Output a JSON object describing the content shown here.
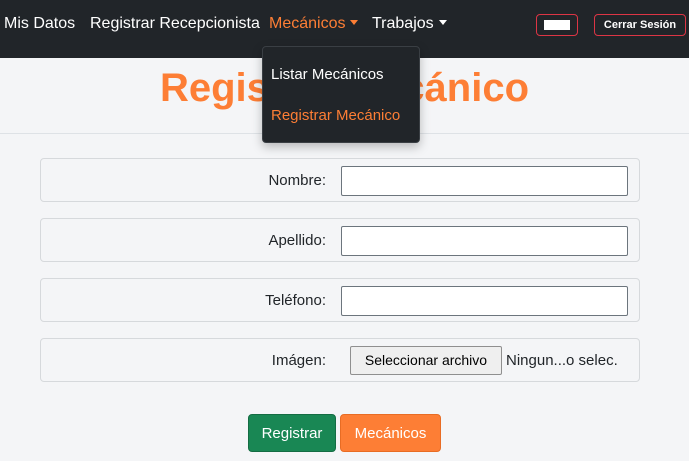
{
  "colors": {
    "accent": "#fd7e35",
    "navbar_bg": "#212529",
    "danger": "#dc3545",
    "success": "#198754"
  },
  "navbar": {
    "items": [
      {
        "label": "Mis Datos"
      },
      {
        "label": "Registrar Recepcionista"
      },
      {
        "label": "Mecánicos"
      },
      {
        "label": "Trabajos"
      }
    ],
    "logout_label": "Cerrar Sesión"
  },
  "dropdown": {
    "items": [
      {
        "label": "Listar Mecánicos"
      },
      {
        "label": "Registrar Mecánico"
      }
    ]
  },
  "page": {
    "title": "Registrar Mecánico"
  },
  "form": {
    "fields": [
      {
        "label": "Nombre:",
        "value": ""
      },
      {
        "label": "Apellido:",
        "value": ""
      },
      {
        "label": "Teléfono:",
        "value": ""
      }
    ],
    "image": {
      "label": "Imágen:",
      "button_label": "Seleccionar archivo",
      "status": "Ningun...o selec."
    },
    "submit_label": "Registrar",
    "secondary_label": "Mecánicos"
  }
}
